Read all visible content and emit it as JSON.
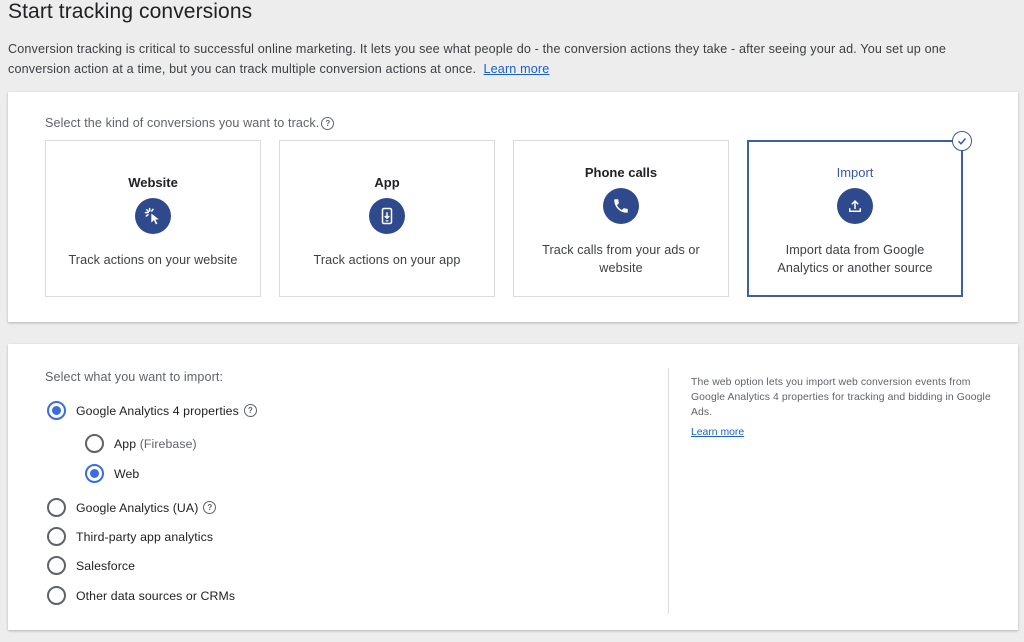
{
  "header": {
    "title": "Start tracking conversions",
    "intro": "Conversion tracking is critical to successful online marketing. It lets you see what people do - the conversion actions they take - after seeing your ad. You set up one conversion action at a time, but you can track multiple conversion actions at once.",
    "learn_more": "Learn more"
  },
  "kind": {
    "label": "Select the kind of conversions you want to track.",
    "cards": [
      {
        "title": "Website",
        "icon": "cursor-click-icon",
        "desc": "Track actions on your website"
      },
      {
        "title": "App",
        "icon": "phone-download-icon",
        "desc": "Track actions on your app"
      },
      {
        "title": "Phone calls",
        "icon": "phone-call-icon",
        "desc": "Track calls from your ads or website"
      },
      {
        "title": "Import",
        "icon": "upload-icon",
        "desc": "Import data from Google Analytics or another source",
        "selected": true
      }
    ]
  },
  "import": {
    "label": "Select what you want to import:",
    "options": {
      "ga4": "Google Analytics 4 properties",
      "app": "App",
      "app_suffix": "(Firebase)",
      "web": "Web",
      "ua": "Google Analytics (UA)",
      "third_party": "Third-party app analytics",
      "salesforce": "Salesforce",
      "other": "Other data sources or CRMs"
    },
    "selected": [
      "ga4",
      "web"
    ],
    "side_text": "The web option lets you import web conversion events from Google Analytics 4 properties for tracking and bidding in Google Ads.",
    "side_link": "Learn more"
  },
  "colors": {
    "accent": "#3b6de0",
    "icon_bg": "#2f4a8c",
    "selected_border": "#3f5fa3",
    "link": "#1a5fd1"
  }
}
